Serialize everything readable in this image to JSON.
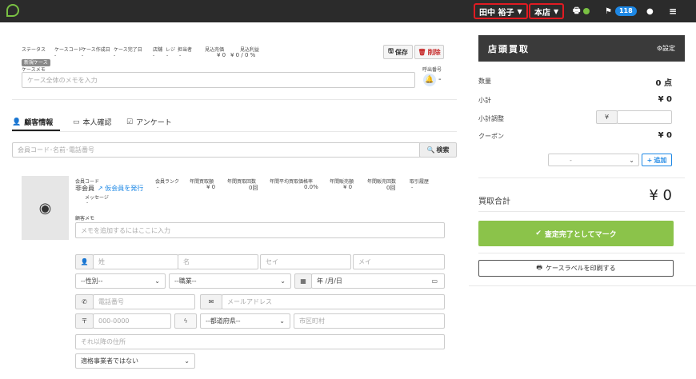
{
  "topbar": {
    "user": "田中 裕子",
    "store": "本店",
    "notif_count": "118"
  },
  "case": {
    "status_label": "ステータス",
    "status_value": "新規ケース",
    "code_label": "ケースコード",
    "created_label": "ケース作成日",
    "completed_label": "ケース完了日",
    "store_label": "店舗",
    "register_label": "レジ",
    "staff_label": "担当者",
    "sale_label": "見込売価",
    "profit_label": "見込利益",
    "sale_value": "¥ 0",
    "profit_value": "¥ 0 / 0 %",
    "dash": "-",
    "save": "保存",
    "delete": "削除",
    "memo_label": "ケースメモ",
    "memo_placeholder": "ケース全体のメモを入力",
    "call_label": "呼出番号",
    "call_value": "-"
  },
  "tabs": [
    {
      "label": "顧客情報"
    },
    {
      "label": "本人確認"
    },
    {
      "label": "アンケート"
    }
  ],
  "search": {
    "placeholder": "会員コード･名前･電話番号",
    "button": "検索"
  },
  "customer": {
    "code_label": "会員コード",
    "nonmember": "非会員",
    "issue_link": "仮会員を発行",
    "message_label": "メッセージ",
    "message_value": "-",
    "rank_label": "会員ランク",
    "rank_value": "-",
    "annual_buy_amt_label": "年間買取額",
    "annual_buy_amt": "¥ 0",
    "annual_buy_cnt_label": "年間買取回数",
    "annual_buy_cnt": "0回",
    "annual_rate_label": "年間平均買取価格率",
    "annual_rate": "0.0%",
    "annual_sale_amt_label": "年間販売額",
    "annual_sale_amt": "¥ 0",
    "annual_sale_cnt_label": "年間販売回数",
    "annual_sale_cnt": "0回",
    "history_label": "取引履歴",
    "history_value": "-",
    "memo_label": "顧客メモ",
    "memo_placeholder": "メモを追加するにはここに入力"
  },
  "form": {
    "sei": "姓",
    "mei": "名",
    "sei_kana": "セイ",
    "mei_kana": "メイ",
    "gender": "--性別--",
    "job": "--職業--",
    "date": "年 /月/日",
    "phone": "電話番号",
    "email": "メールアドレス",
    "zip": "000-0000",
    "pref": "--都道府県--",
    "city": "市区町村",
    "address": "それ以降の住所",
    "business": "適格事業者ではない"
  },
  "panel": {
    "title": "店頭買取",
    "settings": "設定",
    "qty_label": "数量",
    "qty_value": "0 点",
    "subtotal_label": "小計",
    "subtotal_value": "¥ 0",
    "adjust_label": "小計調整",
    "yen": "¥",
    "coupon_label": "クーポン",
    "coupon_value": "¥ 0",
    "coupon_select": "-",
    "add": "追加",
    "total_label": "買取合計",
    "total_value": "¥ 0",
    "mark_button": "査定完了としてマーク",
    "print_button": "ケースラベルを印刷する"
  }
}
